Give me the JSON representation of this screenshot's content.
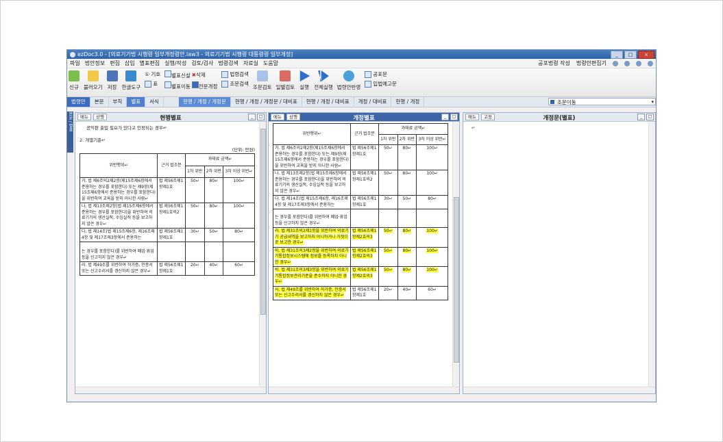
{
  "window": {
    "title": "ezDoc3.0 - [의료기기법 시행령 일부개정령안.law3 - 의료기기법 시행령 대통령령 일부개정]",
    "controls": [
      "_",
      "□",
      "×"
    ]
  },
  "menubar": {
    "items": [
      "파일",
      "법안정보",
      "편집",
      "삽입",
      "별표편집",
      "실행/작성",
      "검토/검사",
      "법령검색",
      "자료실",
      "도움말"
    ],
    "right": [
      "공포법령 작성",
      "법령안편집기"
    ]
  },
  "toolbar": {
    "new": "신규",
    "open": "불러오기",
    "save": "저장",
    "hangul": "한글도구",
    "sym": "① 기호",
    "table": "표",
    "new_table": "별표신설",
    "delete": "삭제",
    "move_table": "별표이동",
    "full_edit": "전문개정",
    "law_search": "법령검색",
    "clause_search": "조문검색",
    "clause_review": "조문검토",
    "law_review": "일별검토",
    "run": "실행",
    "run_all": "전체실행",
    "reflect": "법령안반영",
    "promulgate": "공포문",
    "notice": "입법예고문"
  },
  "tabs": {
    "items": [
      "법령안",
      "본문",
      "부칙",
      "별표",
      "서식"
    ],
    "views": [
      "현행 / 개정 / 개정문",
      "현행 / 개정 / 개정문 / 대비표",
      "현행 / 개정 / 대비표",
      "개정 / 대비표",
      "현행 / 개정"
    ],
    "jump": "조문이동"
  },
  "left_strip": "본문 / 별표",
  "panels": {
    "current": {
      "title": "현행별표",
      "menu": "메뉴",
      "btn": "상행"
    },
    "revised": {
      "title": "개정별표",
      "menu": "메뉴",
      "btn": "상행"
    },
    "text": {
      "title": "개정문(별표)",
      "menu": "메뉴",
      "btn": "고정"
    }
  },
  "current_doc": {
    "intro": "공익판 출입 필요가 있다고 인정되는 경우↵",
    "section": "2. 개별기준↵",
    "unit": "(단위: 만원)",
    "head": {
      "violation": "위반행위↵",
      "basis": "근거 법조문",
      "penalty": "과태료 금액↵",
      "c1": "1차 위반",
      "c2": "2차 위반",
      "c3": "3차 이상 위반↵"
    },
    "rows": [
      {
        "v": "가. 법 제6조의2제2항(제15조제6항에서 준용하는 경우를 포함한다) 또는 제9항(제15조제6항에서 준용하는 경우를 포함한다)을 위반하여 교육을 받지 아니한 사람↵",
        "b": "법 제56조제1항제1호",
        "a": "50↵",
        "b2": "80↵",
        "c": "100↵"
      },
      {
        "v": "나. 법 제13조제2항(법 제15조제6항에서 준용하는 경우를 포함한다)을 위반하여 의료기기의 생산실적, 수입실적 등을 보고하지 않은 경우↵",
        "b": "법 제56조제1항제1호의2",
        "a": "50↵",
        "b2": "80↵",
        "c": "100↵"
      },
      {
        "v": "다. 법 제14조(법 제15조제6항, 제16조제4항 및 제17조제3항에서 준용하는",
        "b": "법 제56조제1항제1호",
        "a": "30↵",
        "b2": "50↵",
        "c": "80↵"
      }
    ],
    "cont": "는 경우를 포함한다)를 위반하여 폐업·휴업 등을 신고하지 않은 경우↵",
    "last": {
      "v": "라. 법 제49조를 위반하여 허가증, 인증서 또는 신고수리서를 갱신하지 않은 경우↵",
      "b": "법 제56조제1항제1호",
      "a": "20↵",
      "b2": "40↵",
      "c": "60↵"
    }
  },
  "revised_doc": {
    "head": {
      "violation": "위반행위↵",
      "basis": "근거 법조문",
      "penalty": "과태료 금액↵",
      "c1": "1차 위반",
      "c2": "2차 위반",
      "c3": "3차 이상 위반↵"
    },
    "rows": [
      {
        "v": "가. 법 제6조의2제2항(제15조제6항에서 준용하는 경우를 포함한다) 또는 제9항(제15조제6항에서 준용하는 경우를 포함한다)을 위반하여 교육을 받지 아니한 사람↵",
        "b": "법 제56조제1항제1호",
        "a": "50↵",
        "b2": "80↵",
        "c": "100↵"
      },
      {
        "v": "나. 법 제13조제2항(법 제15조제6항에서 준용하는 경우를 포함한다)을 위반하여 의료기기의 생산실적, 수입실적 등을 보고하지 않은 경우↵",
        "b": "법 제56조제1항제1호의2",
        "a": "50↵",
        "b2": "80↵",
        "c": "100↵"
      },
      {
        "v": "다. 법 제14조(법 제15조제6항, 제16조제4항 및 제17조제3항에서 준용하는",
        "b": "법 제56조제1항제1호",
        "a": "30↵",
        "b2": "50↵",
        "c": "80↵"
      }
    ],
    "cont": "는 경우를 포함한다)를 위반하여 폐업·휴업 등을 신고하지 않은 경우↵",
    "new_rows": [
      {
        "v": "라. 법 제31조의2제1항을 위반하여 의료기기 공급내역을 보고하지 아니하거나 거짓으로 보고한 경우↵",
        "b": "법 제56조제1항제2호의3",
        "a": "50↵",
        "b2": "80↵",
        "c": "100↵"
      },
      {
        "v": "마. 법 제31조의3제2항을 위반하여 의료기기통합정보시스템에 정보를 등록하지 아니한 경우↵",
        "b": "법 제56조제1항제2호의3",
        "a": "50↵",
        "b2": "80↵",
        "c": "100↵"
      },
      {
        "v": "바. 법 제31조의3제3항을 위반하여 의료기기통합정보관리기준을 준수하지 아니한 경우↵",
        "b": "법 제56조제1항제2호의3",
        "a": "50↵",
        "b2": "80↵",
        "c": "100↵"
      }
    ],
    "last": {
      "v": "사. 법 제49조를 위반하여 허가증, 인증서 또는 신고수리서를 갱신하지 않은 경우↵",
      "b": "법 제56조제1항제1호",
      "a": "20↵",
      "b2": "40↵",
      "c": "60↵"
    }
  },
  "text_doc": {
    "mark": "↵"
  }
}
